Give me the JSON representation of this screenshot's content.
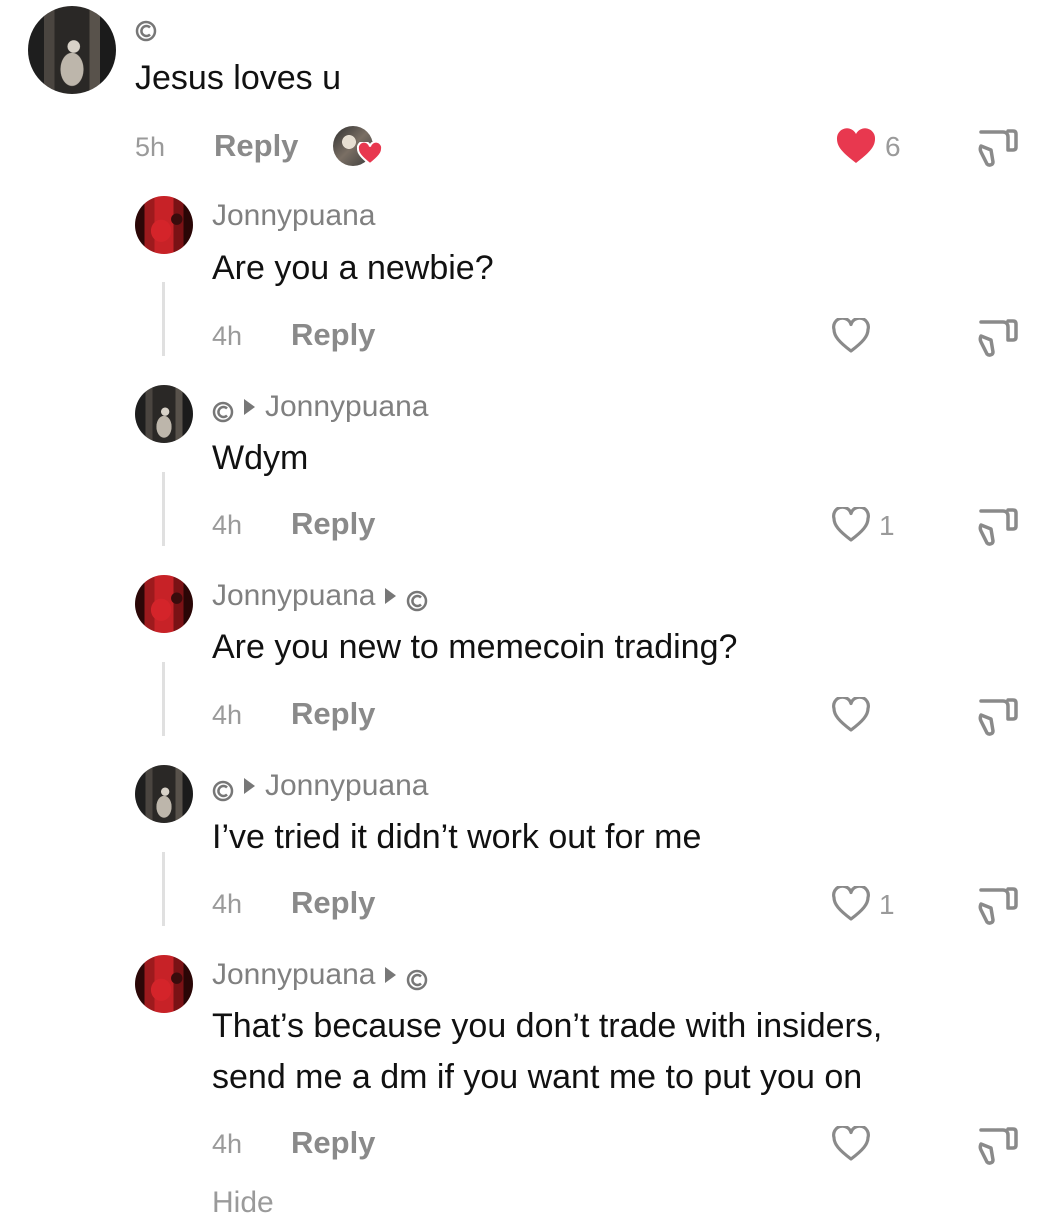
{
  "colors": {
    "heart_active": "#e8384f",
    "muted": "#8a8a8a",
    "text": "#111111"
  },
  "main_comment": {
    "text": "Jesus loves u",
    "time": "5h",
    "reply_label": "Reply",
    "likes": "6",
    "liked": true,
    "creator_liked": true
  },
  "replies": [
    {
      "author": "Jonnypuana",
      "text_lines": [
        "Are you a newbie?"
      ],
      "time": "4h",
      "reply_label": "Reply",
      "likes": ""
    },
    {
      "author": "Jonnypuana",
      "text_lines": [
        "Wdym"
      ],
      "time": "4h",
      "reply_label": "Reply",
      "likes": "1"
    },
    {
      "author": "Jonnypuana",
      "text_lines": [
        "Are you new to memecoin trading?"
      ],
      "time": "4h",
      "reply_label": "Reply",
      "likes": ""
    },
    {
      "author": "Jonnypuana",
      "text_lines": [
        "I’ve tried it didn’t work out for me"
      ],
      "time": "4h",
      "reply_label": "Reply",
      "likes": "1"
    },
    {
      "author": "Jonnypuana",
      "text_lines": [
        "That’s because you don’t trade with insiders,",
        "send me a dm if you want me to put you on"
      ],
      "time": "4h",
      "reply_label": "Reply",
      "likes": ""
    }
  ],
  "footer": {
    "hide_label": "Hide"
  }
}
